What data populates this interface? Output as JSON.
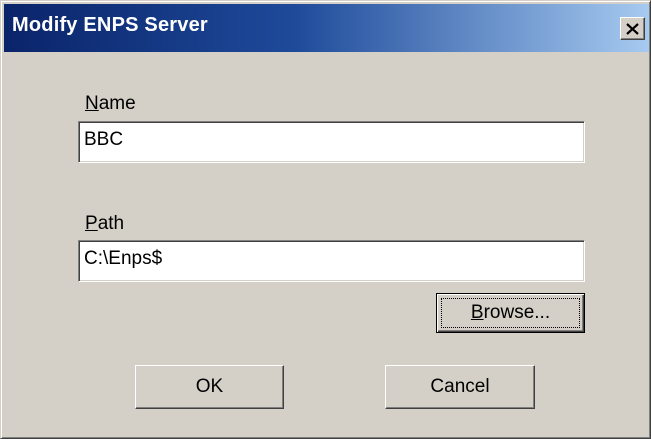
{
  "window": {
    "title": "Modify ENPS Server",
    "close_glyph": "✕"
  },
  "name_field": {
    "label_accel": "N",
    "label_rest": "ame",
    "value": "BBC"
  },
  "path_field": {
    "label_accel": "P",
    "label_rest": "ath",
    "value": "C:\\Enps$"
  },
  "buttons": {
    "browse_accel": "B",
    "browse_rest": "rowse...",
    "ok": "OK",
    "cancel": "Cancel"
  },
  "icons": {
    "close": "close-icon"
  },
  "colors": {
    "title_start": "#0a246a",
    "title_end": "#a6caf0",
    "face": "#d4d0c8"
  }
}
